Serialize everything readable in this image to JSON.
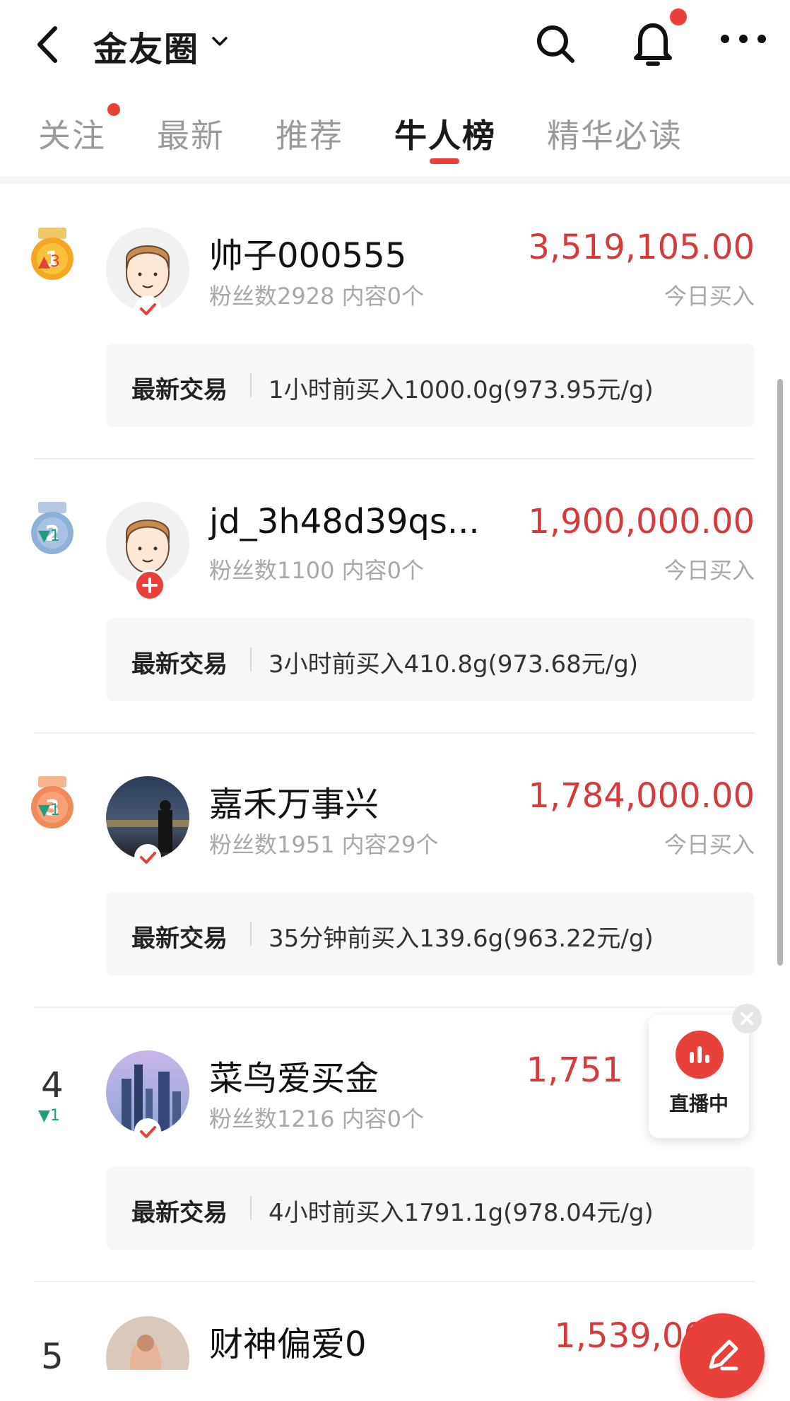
{
  "header": {
    "title": "金友圈",
    "icons": [
      "back-arrow-icon",
      "chevron-down-icon",
      "search-icon",
      "bell-icon",
      "more-icon"
    ]
  },
  "tabs": [
    {
      "label": "关注",
      "has_dot": true
    },
    {
      "label": "最新"
    },
    {
      "label": "推荐"
    },
    {
      "label": "牛人榜",
      "active": true
    },
    {
      "label": "精华必读"
    }
  ],
  "colors": {
    "accent": "#e8413a",
    "amount": "#d63a3a",
    "trend_up": "#e8413a",
    "trend_down": "#1f9e78"
  },
  "entries": [
    {
      "rank": "1",
      "medal": "gold",
      "trend": "▲3",
      "trend_dir": "up",
      "name": "帅子000555",
      "meta": "粉丝数2928 内容0个",
      "amount": "3,519,105.00",
      "amount_label": "今日买入",
      "trade_label": "最新交易",
      "trade_text": "1小时前买入1000.0g(973.95元/g)",
      "badge": "check"
    },
    {
      "rank": "2",
      "medal": "silver",
      "trend": "▼1",
      "trend_dir": "down",
      "name": "jd_3h48d39qs...",
      "meta": "粉丝数1100 内容0个",
      "amount": "1,900,000.00",
      "amount_label": "今日买入",
      "trade_label": "最新交易",
      "trade_text": "3小时前买入410.8g(973.68元/g)",
      "badge": "plus"
    },
    {
      "rank": "3",
      "medal": "bronze",
      "trend": "▼1",
      "trend_dir": "down",
      "name": "嘉禾万事兴",
      "meta": "粉丝数1951 内容29个",
      "amount": "1,784,000.00",
      "amount_label": "今日买入",
      "trade_label": "最新交易",
      "trade_text": "35分钟前买入139.6g(963.22元/g)",
      "badge": "check"
    },
    {
      "rank": "4",
      "trend": "▼1",
      "trend_dir": "down",
      "name": "菜鸟爱买金",
      "meta": "粉丝数1216 内容0个",
      "amount": "1,751",
      "amount_label": "",
      "trade_label": "最新交易",
      "trade_text": "4小时前买入1791.1g(978.04元/g)",
      "badge": "check"
    },
    {
      "rank": "5",
      "name": "财神偏爱0",
      "amount": "1,539,00"
    }
  ],
  "live": {
    "label": "直播中"
  },
  "fab": {
    "icon": "edit-icon"
  }
}
